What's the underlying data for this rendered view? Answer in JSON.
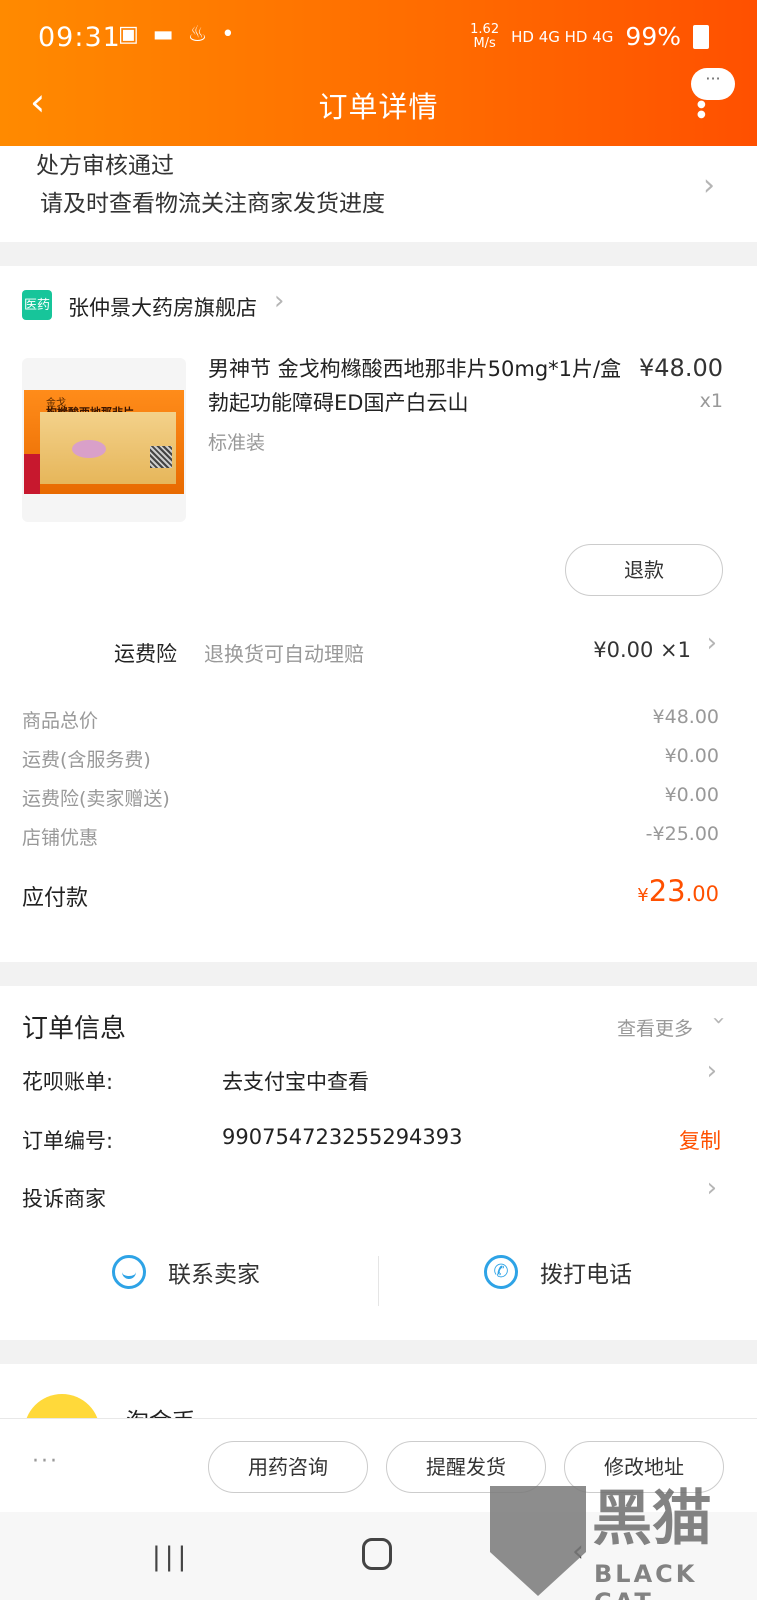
{
  "status_bar": {
    "time": "09:31",
    "speed": "1.62\nM/s",
    "signal": "HD 4G HD 4G",
    "battery": "99%"
  },
  "header": {
    "title": "订单详情",
    "more_bubble": "···"
  },
  "prescription": {
    "line1": "处方审核通过",
    "line2": "请及时查看物流关注商家发货进度"
  },
  "shop": {
    "icon_text": "医药",
    "name": "张仲景大药房旗舰店"
  },
  "product": {
    "title": "男神节 金戈枸橼酸西地那非片50mg*1片/盒勃起功能障碍ED国产白云山",
    "sku": "标准装",
    "price": "¥48.00",
    "qty": "x1",
    "refund_label": "退款",
    "package_brand": "金戈",
    "package_name": "枸橼酸西地那非片"
  },
  "insurance": {
    "label": "运费险",
    "desc": "退换货可自动理赔",
    "value": "¥0.00 ×1"
  },
  "summary": [
    {
      "label": "商品总价",
      "value": "¥48.00"
    },
    {
      "label": "运费(含服务费)",
      "value": "¥0.00"
    },
    {
      "label": "运费险(卖家赠送)",
      "value": "¥0.00"
    },
    {
      "label": "店铺优惠",
      "value": "-¥25.00"
    }
  ],
  "payment": {
    "label": "应付款",
    "currency": "¥",
    "integer": "23",
    "decimal": ".00"
  },
  "order_info": {
    "title": "订单信息",
    "more": "查看更多",
    "huabei_label": "花呗账单:",
    "huabei_value": "去支付宝中查看",
    "order_no_label": "订单编号:",
    "order_no_value": "990754723255294393",
    "copy_label": "复制",
    "complain_label": "投诉商家",
    "contact_seller": "联系卖家",
    "call_phone": "拨打电话"
  },
  "coin": {
    "label": "淘金币"
  },
  "bottom_bar": {
    "more": "···",
    "btn1": "用药咨询",
    "btn2": "提醒发货",
    "btn3": "修改地址"
  },
  "watermark": {
    "zh": "黑猫",
    "en": "BLACK CAT"
  }
}
